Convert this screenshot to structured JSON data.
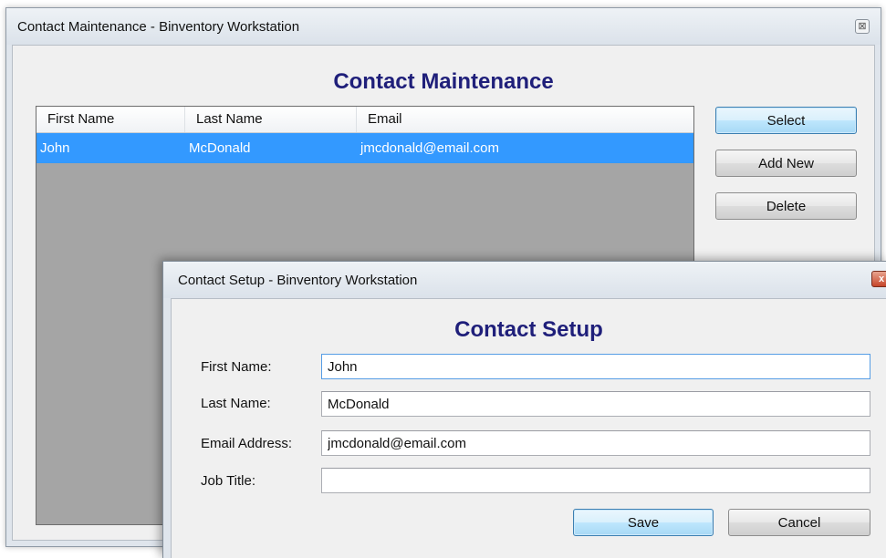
{
  "main_window": {
    "title": "Contact Maintenance - Binventory Workstation",
    "close_glyph": "⊠",
    "heading": "Contact Maintenance",
    "list": {
      "columns": [
        "First Name",
        "Last Name",
        "Email"
      ],
      "rows": [
        {
          "first_name": "John",
          "last_name": "McDonald",
          "email": "jmcdonald@email.com",
          "selected": true
        }
      ]
    },
    "buttons": {
      "select": "Select",
      "add_new": "Add New",
      "delete": "Delete"
    }
  },
  "dialog": {
    "title": "Contact Setup - Binventory Workstation",
    "close_glyph": "x",
    "heading": "Contact Setup",
    "fields": {
      "first_name": {
        "label": "First Name:",
        "value": "John"
      },
      "last_name": {
        "label": "Last Name:",
        "value": "McDonald"
      },
      "email": {
        "label": "Email Address:",
        "value": "jmcdonald@email.com"
      },
      "job_title": {
        "label": "Job Title:",
        "value": ""
      }
    },
    "buttons": {
      "save": "Save",
      "cancel": "Cancel"
    }
  },
  "colors": {
    "heading": "#1f1f7a",
    "selection": "#3399ff",
    "list_background": "#a5a5a5",
    "close_dialog": "#c6452a"
  }
}
